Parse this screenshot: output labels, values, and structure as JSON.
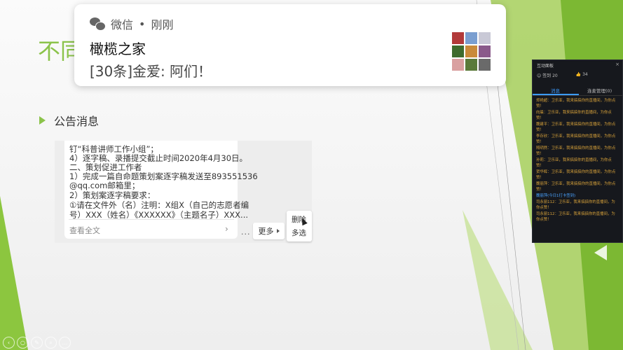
{
  "slide": {
    "title_visible": "不同",
    "bullet": "公告消息"
  },
  "chat": {
    "lines": [
      "钉“科普讲师工作小组”；",
      "4）逐字稿、录播提交截止时间2020年4月30日。",
      "二、策划促进工作者",
      "1）完成一篇自命题策划案逐字稿发送至893551536",
      "@qq.com邮箱里；",
      "2）策划案逐字稿要求：",
      "①请在文件外（名）注明：X组X（自己的志愿者编",
      "号）XXX（姓名）《XXXXXX》（主题名子）XXX..."
    ],
    "read_more": "查看全文",
    "dots": "...",
    "more_label": "更多",
    "menu": {
      "delete": "删除",
      "multi_select": "多选"
    }
  },
  "notification": {
    "app": "微信",
    "separator": "•",
    "time": "刚刚",
    "title": "橄榄之家",
    "body": "[30条]金爱: 阿们！",
    "avatar_colors": [
      "#b23a3a",
      "#7a9ed0",
      "#c9c9d6",
      "#3e6b2e",
      "#c98a3a",
      "#8a5a8a",
      "#d9a0a0",
      "#5a7a3a",
      "#6a6a6a"
    ]
  },
  "panel": {
    "title": "互动面板",
    "close": "×",
    "signin": "签到 20",
    "likes": "34",
    "tab_messages": "消息",
    "tab_manage": "连麦管理(0)",
    "messages": [
      {
        "text": "郑艳超：卫乐亚，我来搞搞你的直播间，为你点赞！",
        "sys": false
      },
      {
        "text": "向晨：卫乐亚，我来搞搞你的直播间，为你点赞！",
        "sys": false
      },
      {
        "text": "魏建平：卫乐亚，我来搞搞你的直播间，为你点赞！",
        "sys": false
      },
      {
        "text": "李存欣：卫乐亚，我来搞搞你的直播间，为你点赞！",
        "sys": false
      },
      {
        "text": "翔玥然：卫乐亚，我来搞搞你的直播间，为你点赞！",
        "sys": false
      },
      {
        "text": "孙莉：卫乐亚，我来搞搞你的直播间，为你点赞！",
        "sys": false
      },
      {
        "text": "贺华辉：卫乐亚，我来搞搞你的直播间，为你点赞！",
        "sys": false
      },
      {
        "text": "魏丽萍：卫乐亚，我来搞搞你的直播间，为你点赞！",
        "sys": false
      },
      {
        "text": "魏丽萍(今日1打卡签到)",
        "sys": true
      },
      {
        "text": "司永丽112：卫乐亚，我来搞搞你的直播间，为你点赞！",
        "sys": false
      },
      {
        "text": "司永丽112：卫乐亚，我来搞搞你的直播间，为你点赞！",
        "sys": false
      }
    ]
  },
  "bottom_tools": [
    "‹",
    "○",
    "✎",
    "⌕",
    "…"
  ]
}
